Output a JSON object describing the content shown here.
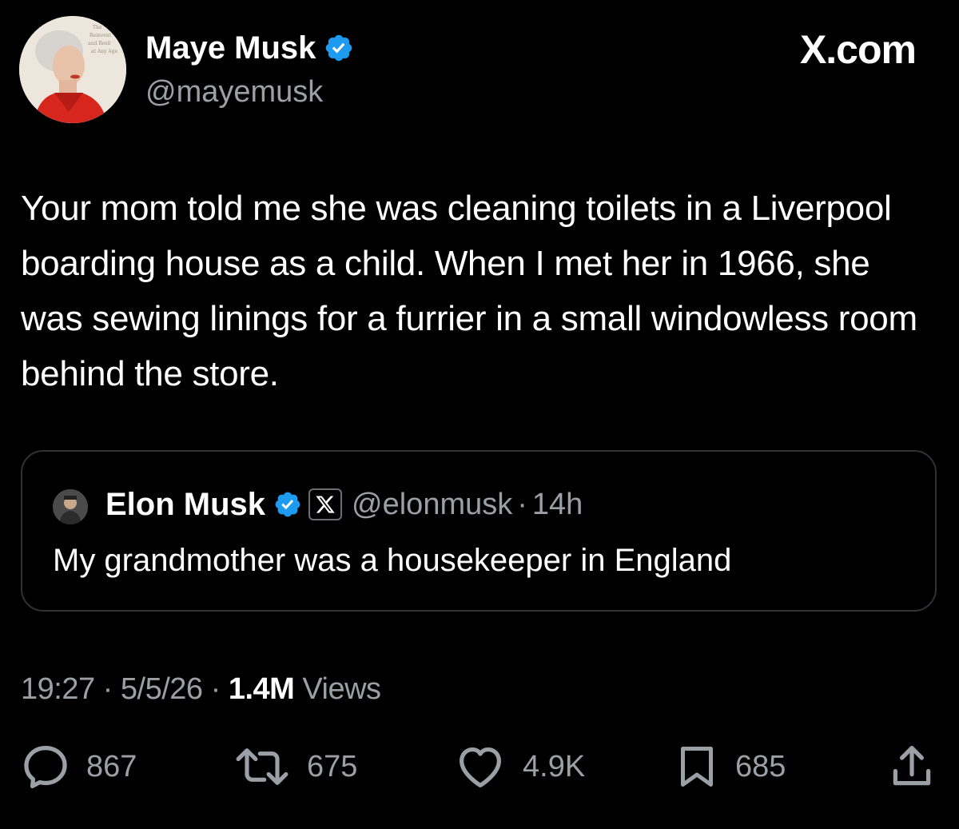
{
  "tweet": {
    "author": {
      "name": "Maye Musk",
      "handle": "@mayemusk",
      "verified": true,
      "avatar_icon": "profile-photo"
    },
    "brand": "X.com",
    "text": "Your mom told me she was cleaning toilets in a Liverpool boarding house as a child. When I met her in 1966, she was sewing linings for a furrier in a small windowless room behind the store.",
    "quoted": {
      "name": "Elon Musk",
      "handle": "@elonmusk",
      "separator": "·",
      "time": "14h",
      "text": "My grandmother was a housekeeper in England",
      "verified": true,
      "affiliation_icon": "x-logo-icon"
    },
    "meta": {
      "time": "19:27",
      "date": "5/5/26",
      "views_count": "1.4M",
      "views_label": "Views",
      "separator": "·"
    },
    "actions": {
      "replies": "867",
      "reposts": "675",
      "likes": "4.9K",
      "bookmarks": "685"
    }
  },
  "colors": {
    "background": "#000000",
    "text": "#ffffff",
    "secondary": "#9aa0a6",
    "verified": "#1d9bf0",
    "border": "#2f3336"
  }
}
